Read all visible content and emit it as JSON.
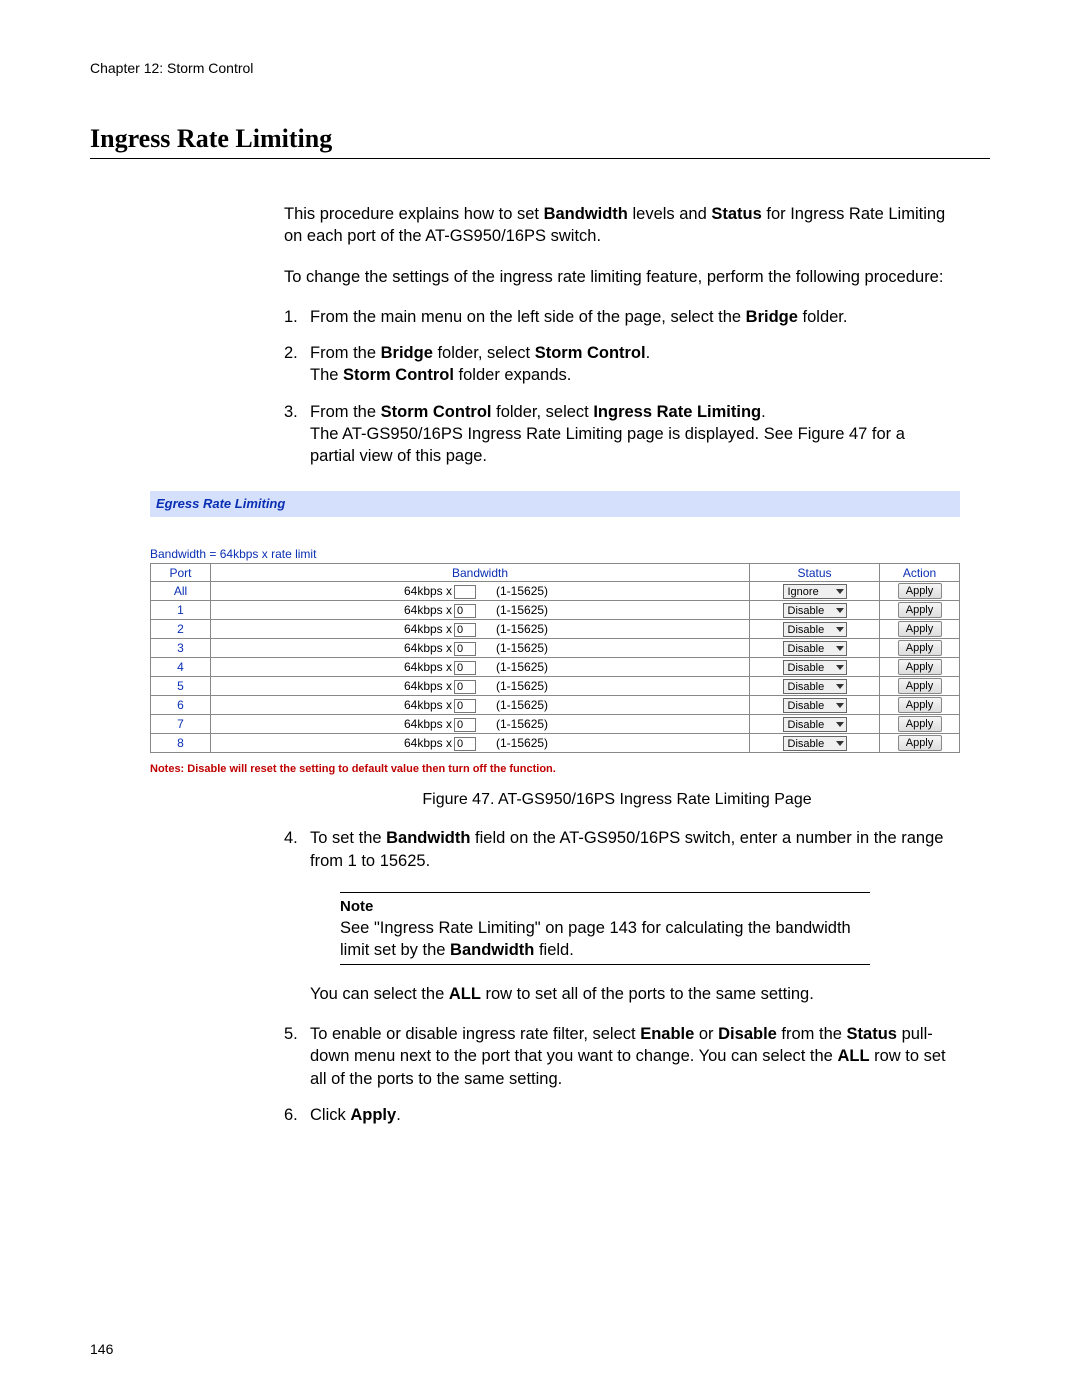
{
  "chapter_header": "Chapter 12: Storm Control",
  "section_title": "Ingress Rate Limiting",
  "intro_html": "This procedure explains how to set <b>Bandwidth</b> levels and <b>Status</b> for Ingress Rate Limiting on each port of the AT-GS950/16PS switch.",
  "lead_in": "To change the settings of the ingress rate limiting feature, perform the following procedure:",
  "steps_group1": [
    "From the main menu on the left side of the page, select the <b>Bridge</b> folder.",
    "From the <b>Bridge</b> folder, select <b>Storm Control</b>.<br>The <b>Storm Control</b> folder expands.",
    "From the <b>Storm Control</b> folder, select <b>Ingress Rate Limiting</b>.<br>The AT-GS950/16PS Ingress Rate Limiting page is displayed. See Figure 47 for a partial view of this page."
  ],
  "figure": {
    "header_title": "Egress Rate Limiting",
    "bandwidth_note": "Bandwidth = 64kbps x rate limit",
    "columns": {
      "port": "Port",
      "bandwidth": "Bandwidth",
      "status": "Status",
      "action": "Action"
    },
    "bw_prefix": "64kbps x",
    "bw_range": "(1-15625)",
    "apply_label": "Apply",
    "rows": [
      {
        "port": "All",
        "value": "",
        "status": "Ignore"
      },
      {
        "port": "1",
        "value": "0",
        "status": "Disable"
      },
      {
        "port": "2",
        "value": "0",
        "status": "Disable"
      },
      {
        "port": "3",
        "value": "0",
        "status": "Disable"
      },
      {
        "port": "4",
        "value": "0",
        "status": "Disable"
      },
      {
        "port": "5",
        "value": "0",
        "status": "Disable"
      },
      {
        "port": "6",
        "value": "0",
        "status": "Disable"
      },
      {
        "port": "7",
        "value": "0",
        "status": "Disable"
      },
      {
        "port": "8",
        "value": "0",
        "status": "Disable"
      }
    ],
    "red_note": "Notes: Disable will reset the setting to default value then turn off the function.",
    "caption": "Figure 47. AT-GS950/16PS Ingress Rate Limiting Page"
  },
  "step4_html": "To set the <b>Bandwidth</b> field on the AT-GS950/16PS switch, enter a number in the range from 1 to 15625.",
  "note": {
    "label": "Note",
    "text_html": "See \"Ingress Rate Limiting\" on page 143 for calculating the bandwidth limit set by the <b>Bandwidth</b> field."
  },
  "after_note_html": "You can select the <b>ALL</b> row to set all of the ports to the same setting.",
  "step5_html": "To enable or disable ingress rate filter, select <b>Enable</b> or <b>Disable</b> from the <b>Status</b> pull-down menu next to the port that you want to change. You can select the <b>ALL</b> row to set all of the ports to the same setting.",
  "step6_html": "Click <b>Apply</b>.",
  "page_number": "146"
}
